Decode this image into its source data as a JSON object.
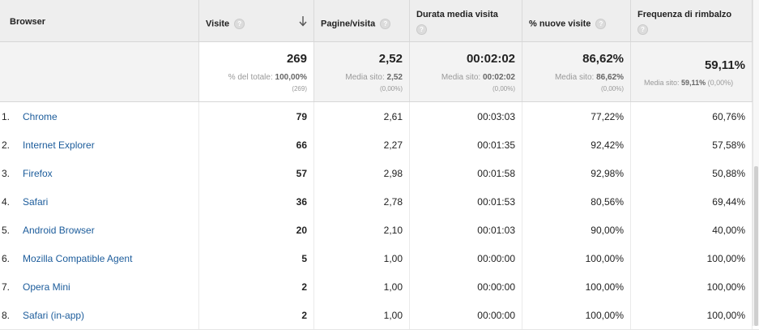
{
  "headers": {
    "browser": "Browser",
    "visits": "Visite",
    "pages_per_visit": "Pagine/visita",
    "avg_duration": "Durata media visita",
    "new_visits": "% nuove visite",
    "bounce_rate": "Frequenza di rimbalzo",
    "help_glyph": "?"
  },
  "totals": {
    "visits": {
      "value": "269",
      "sub_label": "% del totale:",
      "sub_value": "100,00%",
      "pct": "(269)"
    },
    "pages_per_visit": {
      "value": "2,52",
      "sub_label": "Media sito:",
      "sub_value": "2,52",
      "pct": "(0,00%)"
    },
    "avg_duration": {
      "value": "00:02:02",
      "sub_label": "Media sito:",
      "sub_value": "00:02:02",
      "pct": "(0,00%)"
    },
    "new_visits": {
      "value": "86,62%",
      "sub_label": "Media sito:",
      "sub_value": "86,62%",
      "pct": "(0,00%)"
    },
    "bounce_rate": {
      "value": "59,11%",
      "sub_label": "Media sito:",
      "sub_value": "59,11%",
      "pct": "(0,00%)"
    }
  },
  "rows": [
    {
      "num": "1.",
      "browser": "Chrome",
      "visits": "79",
      "pages": "2,61",
      "duration": "00:03:03",
      "new_visits": "77,22%",
      "bounce": "60,76%"
    },
    {
      "num": "2.",
      "browser": "Internet Explorer",
      "visits": "66",
      "pages": "2,27",
      "duration": "00:01:35",
      "new_visits": "92,42%",
      "bounce": "57,58%"
    },
    {
      "num": "3.",
      "browser": "Firefox",
      "visits": "57",
      "pages": "2,98",
      "duration": "00:01:58",
      "new_visits": "92,98%",
      "bounce": "50,88%"
    },
    {
      "num": "4.",
      "browser": "Safari",
      "visits": "36",
      "pages": "2,78",
      "duration": "00:01:53",
      "new_visits": "80,56%",
      "bounce": "69,44%"
    },
    {
      "num": "5.",
      "browser": "Android Browser",
      "visits": "20",
      "pages": "2,10",
      "duration": "00:01:03",
      "new_visits": "90,00%",
      "bounce": "40,00%"
    },
    {
      "num": "6.",
      "browser": "Mozilla Compatible Agent",
      "visits": "5",
      "pages": "1,00",
      "duration": "00:00:00",
      "new_visits": "100,00%",
      "bounce": "100,00%"
    },
    {
      "num": "7.",
      "browser": "Opera Mini",
      "visits": "2",
      "pages": "1,00",
      "duration": "00:00:00",
      "new_visits": "100,00%",
      "bounce": "100,00%"
    },
    {
      "num": "8.",
      "browser": "Safari (in-app)",
      "visits": "2",
      "pages": "1,00",
      "duration": "00:00:00",
      "new_visits": "100,00%",
      "bounce": "100,00%"
    }
  ],
  "icons": {
    "sort": "arrow-down-icon",
    "help": "help-icon"
  }
}
